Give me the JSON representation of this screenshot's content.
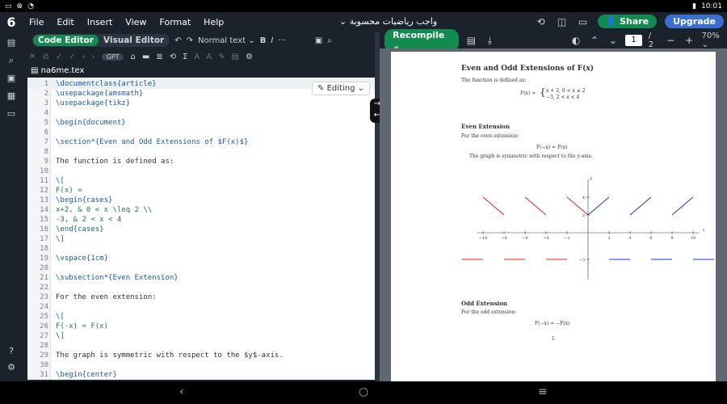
{
  "status": {
    "left_icons": [
      "sim-icon",
      "notif-icon",
      "wifi-icon"
    ],
    "right_text": "10:01",
    "battery": "battery-icon"
  },
  "menubar": {
    "logo": "6",
    "items": [
      "File",
      "Edit",
      "Insert",
      "View",
      "Format",
      "Help"
    ],
    "project_title": "واجب رياضيات محسوبة",
    "share": "Share",
    "upgrade": "Upgrade"
  },
  "toolbar": {
    "code_editor": "Code Editor",
    "visual_editor": "Visual Editor",
    "normal_text": "Normal text",
    "bold": "B",
    "italic": "I",
    "more": "···",
    "gpt": "GPT"
  },
  "file": {
    "name": "na6me.tex",
    "editing_label": "Editing"
  },
  "code_lines": [
    {
      "n": "1",
      "t": "\\documentclass{article}"
    },
    {
      "n": "2",
      "t": "\\usepackage{amsmath}"
    },
    {
      "n": "3",
      "t": "\\usepackage{tikz}"
    },
    {
      "n": "4",
      "t": ""
    },
    {
      "n": "5",
      "t": "\\begin{document}"
    },
    {
      "n": "6",
      "t": ""
    },
    {
      "n": "7",
      "t": "\\section*{Even and Odd Extensions of $F(x)$}"
    },
    {
      "n": "8",
      "t": ""
    },
    {
      "n": "9",
      "t": "The function is defined as:"
    },
    {
      "n": "10",
      "t": ""
    },
    {
      "n": "11",
      "t": "\\["
    },
    {
      "n": "12",
      "t": "F(x) ="
    },
    {
      "n": "13",
      "t": "\\begin{cases}"
    },
    {
      "n": "14",
      "t": "x+2, & 0 < x \\leq 2 \\\\"
    },
    {
      "n": "15",
      "t": "-3, & 2 < x < 4"
    },
    {
      "n": "16",
      "t": "\\end{cases}"
    },
    {
      "n": "17",
      "t": "\\]"
    },
    {
      "n": "18",
      "t": ""
    },
    {
      "n": "19",
      "t": "\\vspace{1cm}"
    },
    {
      "n": "20",
      "t": ""
    },
    {
      "n": "21",
      "t": "\\subsection*{Even Extension}"
    },
    {
      "n": "22",
      "t": ""
    },
    {
      "n": "23",
      "t": "For the even extension:"
    },
    {
      "n": "24",
      "t": ""
    },
    {
      "n": "25",
      "t": "\\["
    },
    {
      "n": "26",
      "t": "F(-x) = F(x)"
    },
    {
      "n": "27",
      "t": "\\]"
    },
    {
      "n": "28",
      "t": ""
    },
    {
      "n": "29",
      "t": "The graph is symmetric with respect to the $y$-axis."
    },
    {
      "n": "30",
      "t": ""
    },
    {
      "n": "31",
      "t": "\\begin{center}"
    }
  ],
  "pdf": {
    "recompile": "Recompile",
    "page_current": "1",
    "page_total": "/ 2",
    "zoom": "70%",
    "title": "Even and Odd Extensions of F(x)",
    "intro": "The function is defined as:",
    "def_lhs": "F(x) =",
    "def_case1": "x + 2,   0 < x ≤ 2",
    "def_case2": "−3,      2 < x < 4",
    "even_heading": "Even Extension",
    "even_intro": "For the even extension:",
    "even_eq": "F(−x) = F(x)",
    "even_note": "The graph is symmetric with respect to the y-axis.",
    "odd_heading": "Odd Extension",
    "odd_intro": "For the odd extension:",
    "odd_eq": "F(−x) = −F(x)",
    "page_number": "1",
    "axis_x": "x",
    "axis_y": "y",
    "x_ticks": [
      "−10",
      "−8",
      "−6",
      "−4",
      "−2",
      "2",
      "4",
      "6",
      "8",
      "10"
    ],
    "y_ticks": [
      "4",
      "2",
      "−3"
    ]
  },
  "chart_data": {
    "type": "line",
    "xlim": [
      -10,
      10
    ],
    "ylim": [
      -3,
      4
    ],
    "series": [
      {
        "color": "#e02020",
        "segments": [
          [
            [
              -10,
              4
            ],
            [
              -8,
              2
            ]
          ],
          [
            [
              -6,
              4
            ],
            [
              -4,
              2
            ]
          ],
          [
            [
              -2,
              4
            ],
            [
              0,
              2
            ]
          ],
          [
            [
              -12,
              -3
            ],
            [
              -10,
              -3
            ]
          ],
          [
            [
              -8,
              -3
            ],
            [
              -6,
              -3
            ]
          ],
          [
            [
              -4,
              -3
            ],
            [
              -2,
              -3
            ]
          ]
        ]
      },
      {
        "color": "#2030e0",
        "segments": [
          [
            [
              0,
              2
            ],
            [
              2,
              4
            ]
          ],
          [
            [
              4,
              2
            ],
            [
              6,
              4
            ]
          ],
          [
            [
              8,
              2
            ],
            [
              10,
              4
            ]
          ],
          [
            [
              2,
              -3
            ],
            [
              4,
              -3
            ]
          ],
          [
            [
              6,
              -3
            ],
            [
              8,
              -3
            ]
          ],
          [
            [
              10,
              -3
            ],
            [
              12,
              -3
            ]
          ]
        ]
      }
    ]
  },
  "colors": {
    "accent": "#138a50",
    "brand": "#3b6fcf"
  }
}
